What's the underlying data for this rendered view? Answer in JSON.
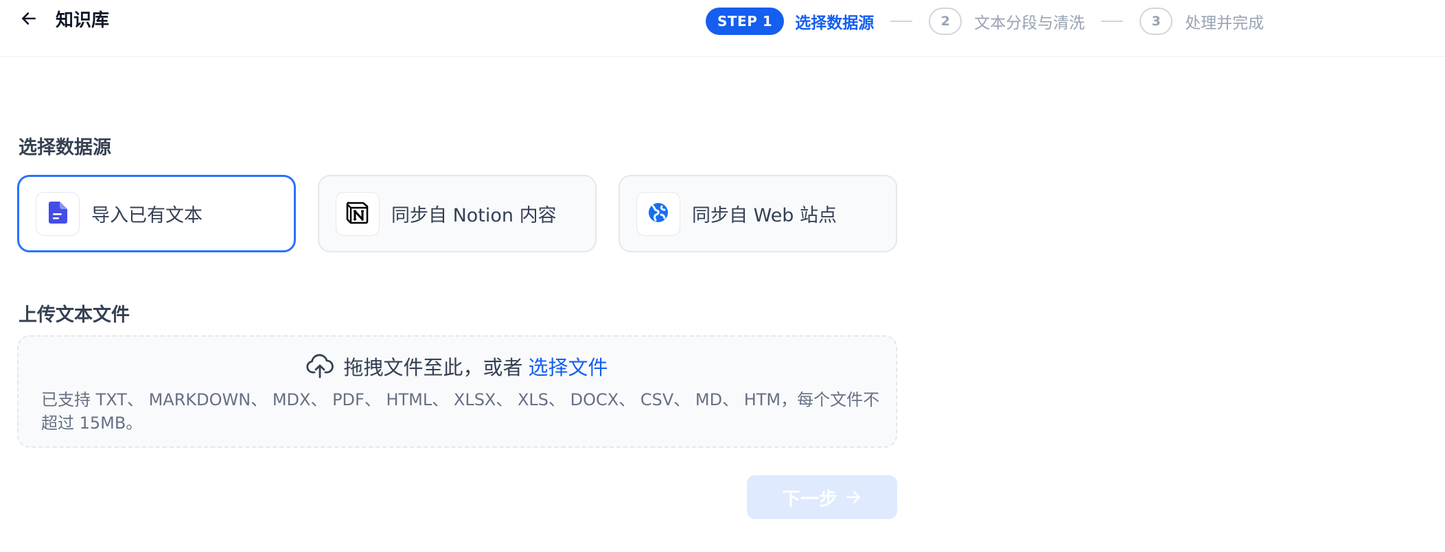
{
  "header": {
    "back_icon": "arrow-left-icon",
    "title": "知识库"
  },
  "stepper": {
    "active_badge": "STEP 1",
    "active_label": "选择数据源",
    "steps": [
      {
        "number": "2",
        "label": "文本分段与清洗"
      },
      {
        "number": "3",
        "label": "处理并完成"
      }
    ],
    "accent_color": "#155eef"
  },
  "datasource": {
    "title": "选择数据源",
    "options": [
      {
        "label": "导入已有文本",
        "icon": "document-icon",
        "selected": true
      },
      {
        "label": "同步自 Notion 内容",
        "icon": "notion-icon",
        "selected": false
      },
      {
        "label": "同步自 Web 站点",
        "icon": "web-globe-icon",
        "selected": false
      }
    ]
  },
  "upload": {
    "title": "上传文本文件",
    "drop_text": "拖拽文件至此，或者",
    "browse_label": "选择文件",
    "hint": "已支持 TXT、 MARKDOWN、 MDX、 PDF、 HTML、 XLSX、 XLS、 DOCX、 CSV、 MD、 HTM，每个文件不超过 15MB。"
  },
  "actions": {
    "next_label": "下一步",
    "next_enabled": false
  }
}
